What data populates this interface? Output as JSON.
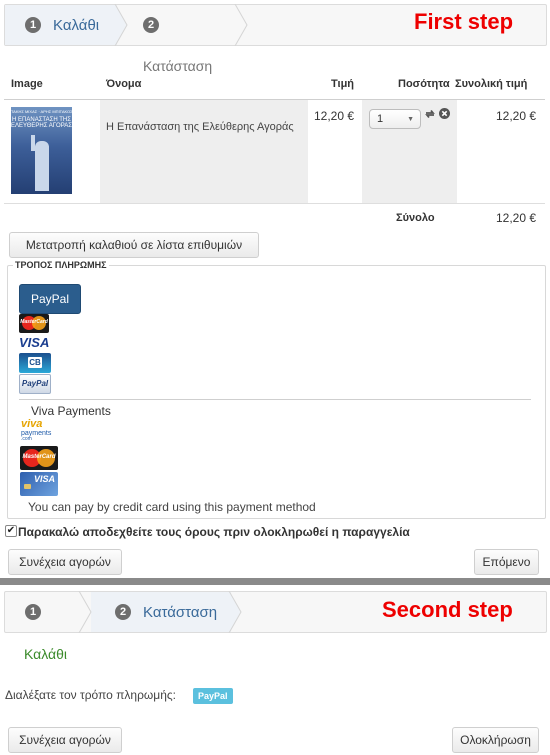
{
  "step1": {
    "annotation": "First step",
    "steps": [
      {
        "num": "1",
        "label": "Καλάθι"
      },
      {
        "num": "2",
        "label": ""
      }
    ],
    "status_heading": "Κατάσταση",
    "columns": {
      "image": "Image",
      "name": "Όνομα",
      "price": "Τιμή",
      "qty": "Ποσότητα",
      "total": "Συνολική τιμή"
    },
    "item": {
      "cover_lines": [
        "ΤΑΚΗΣ ΜΙΧΑΣ · ΑΡΗΣ ΜΠΙΤΑΚΟΣ",
        "Η ΕΠΑΝΑΣΤΑΣΗ ΤΗΣ",
        "ΕΛΕΥΘΕΡΗΣ ΑΓΟΡΑΣ"
      ],
      "name": "Η Επανάσταση της Ελεύθερης Αγοράς",
      "price": "12,20 €",
      "qty": "1",
      "total": "12,20 €"
    },
    "sum_label": "Σύνολο",
    "sum_value": "12,20 €",
    "wishlist_button": "Μετατροπή καλαθιού σε λίστα επιθυμιών",
    "payment_legend": "ΤΡΟΠΟΣ ΠΛΗΡΩΜΗΣ",
    "paypal_button": "PayPal",
    "card_labels": {
      "mastercard": "MasterCard",
      "visa": "VISA",
      "cb": "CB",
      "paypal": "PayPal"
    },
    "viva_label": "Viva Payments",
    "viva_logo": "viva",
    "viva_logo_sub": "payments",
    "viva_logo_com": ".com",
    "viva_note": "You can pay by credit card using this payment method",
    "terms": "Παρακαλώ αποδεχθείτε τους όρους πριν ολοκληρωθεί η παραγγελία",
    "continue_button": "Συνέχεια αγορών",
    "next_button": "Επόμενο"
  },
  "step2": {
    "annotation": "Second step",
    "steps": [
      {
        "num": "1",
        "label": ""
      },
      {
        "num": "2",
        "label": "Κατάσταση"
      }
    ],
    "cart_title": "Καλάθι",
    "chosen_label": "Διαλέξατε τον τρόπο πληρωμής:",
    "chosen_badge": "PayPal",
    "continue_button": "Συνέχεια αγορών",
    "finish_button": "Ολοκλήρωση"
  },
  "colors": {
    "accent": "#3a6a9a",
    "annotation": "#e00000",
    "paypal_button": "#2b5d8d",
    "badge": "#5bc0de"
  }
}
